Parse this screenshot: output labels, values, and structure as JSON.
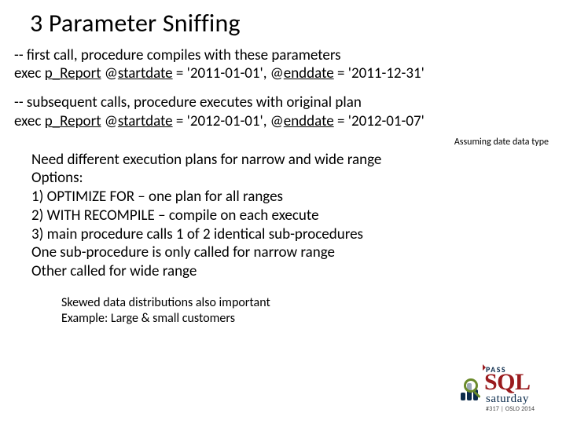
{
  "title": "3 Parameter Sniffing",
  "code1": {
    "comment": "-- first call, procedure compiles with these parameters",
    "stmt_pre": "exec ",
    "stmt_u1": "p_Report",
    "stmt_mid1": " @",
    "stmt_u2": "startdate",
    "stmt_mid2": " = '2011-01-01', @",
    "stmt_u3": "enddate",
    "stmt_post": " = '2011-12-31'"
  },
  "code2": {
    "comment": "-- subsequent calls, procedure executes with original plan",
    "stmt_pre": "exec ",
    "stmt_u1": "p_Report",
    "stmt_mid1": " @",
    "stmt_u2": "startdate",
    "stmt_mid2": " = '2012-01-01', @",
    "stmt_u3": "enddate",
    "stmt_post": " = '2012-01-07'"
  },
  "caption": "Assuming date data type",
  "body": {
    "l1": "Need different execution plans for narrow and wide range",
    "l2": "Options:",
    "l3": "1) OPTIMIZE FOR – one plan for all ranges",
    "l4": "2) WITH RECOMPILE – compile on each execute",
    "l5": "3) main procedure calls 1 of 2 identical sub-procedures",
    "l6": "One sub-procedure is only called for narrow range",
    "l7": "Other called for wide range"
  },
  "foot": {
    "l1": "Skewed data distributions also important",
    "l2": "Example: Large & small customers"
  },
  "logo": {
    "pass": "PASS",
    "sql": "SQL",
    "sat": "saturday",
    "sub": "#317 | OSLO 2014"
  }
}
